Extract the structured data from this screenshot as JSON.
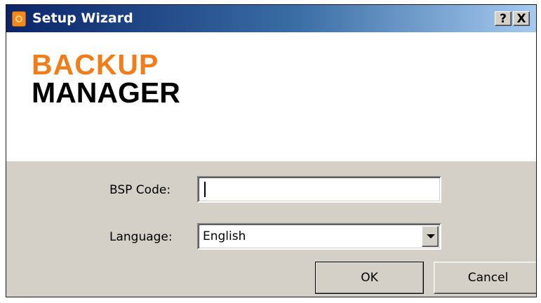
{
  "window": {
    "title": "Setup Wizard",
    "help_label": "?",
    "close_label": "X"
  },
  "banner": {
    "logo_line1": "BACKUP",
    "logo_line2": "MANAGER"
  },
  "form": {
    "bsp_code_label": "BSP Code:",
    "bsp_code_value": "",
    "language_label": "Language:",
    "language_value": "English"
  },
  "buttons": {
    "ok_label": "OK",
    "cancel_label": "Cancel"
  },
  "colors": {
    "logo_orange": "#f07d19",
    "logo_black": "#000000",
    "titlebar_start": "#0a246a",
    "titlebar_end": "#a6caf0",
    "dialog_bg": "#d4d0c8"
  }
}
